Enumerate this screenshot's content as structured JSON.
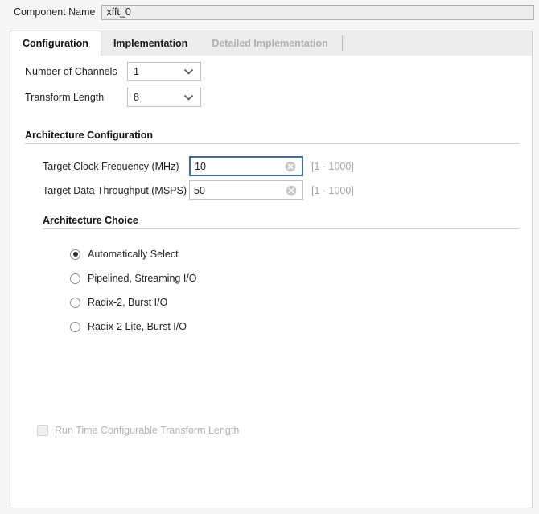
{
  "window": {
    "component_name_label": "Component Name",
    "component_name_value": "xfft_0"
  },
  "tabs": [
    {
      "label": "Configuration",
      "state": "active"
    },
    {
      "label": "Implementation",
      "state": "enabled"
    },
    {
      "label": "Detailed Implementation",
      "state": "disabled"
    }
  ],
  "configuration": {
    "number_of_channels": {
      "label": "Number of Channels",
      "value": "1",
      "arrow_icon": "chevron-down-icon"
    },
    "transform_length": {
      "label": "Transform Length",
      "value": "8",
      "arrow_icon": "chevron-down-icon"
    },
    "architecture_configuration": {
      "title": "Architecture Configuration",
      "target_clock_frequency": {
        "label": "Target Clock Frequency (MHz)",
        "value": "10",
        "hint": "[1 - 1000]",
        "clear_icon": "clear-circle-icon",
        "focused": true
      },
      "target_data_throughput": {
        "label": "Target Data Throughput (MSPS)",
        "value": "50",
        "hint": "[1 - 1000]",
        "clear_icon": "clear-circle-icon",
        "focused": false
      },
      "architecture_choice": {
        "title": "Architecture Choice",
        "options": [
          {
            "label": "Automatically Select",
            "checked": true
          },
          {
            "label": "Pipelined, Streaming I/O",
            "checked": false
          },
          {
            "label": "Radix-2, Burst I/O",
            "checked": false
          },
          {
            "label": "Radix-2 Lite, Burst I/O",
            "checked": false
          }
        ]
      }
    },
    "run_time_configurable": {
      "label": "Run Time Configurable Transform Length",
      "checked": false,
      "disabled": true
    }
  },
  "colors": {
    "focus_border": "#3b6ea5",
    "panel_background": "#ffffff",
    "window_background": "#f5f5f5",
    "tabbar_background": "#ececec",
    "disabled_text": "#b0b0b0"
  }
}
